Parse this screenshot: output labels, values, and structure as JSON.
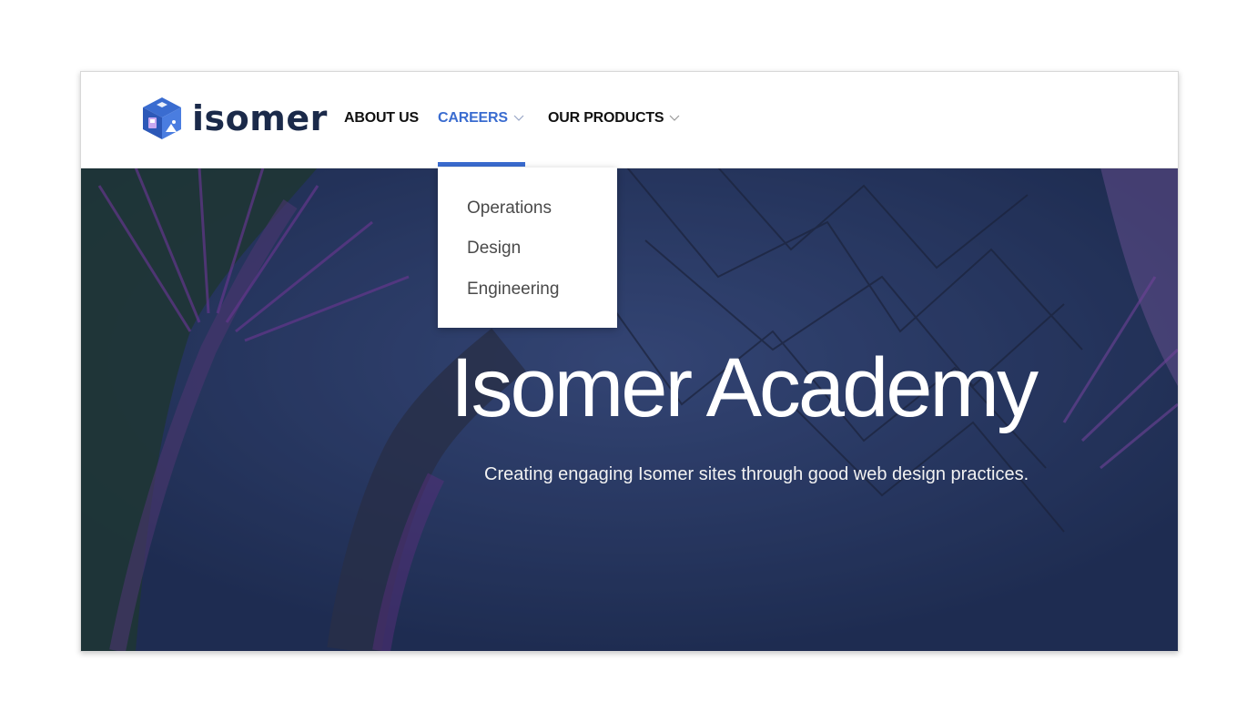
{
  "brand": {
    "logo_icon": "isomer-cube-icon",
    "name": "isomer"
  },
  "nav": {
    "items": [
      {
        "label": "ABOUT US",
        "has_chevron": false
      },
      {
        "label": "CAREERS",
        "has_chevron": true,
        "active": true
      },
      {
        "label": "OUR PRODUCTS",
        "has_chevron": true
      }
    ]
  },
  "dropdown": {
    "items": [
      {
        "label": "Operations"
      },
      {
        "label": "Design"
      },
      {
        "label": "Engineering"
      }
    ]
  },
  "hero": {
    "title": "Isomer Academy",
    "subtitle": "Creating engaging Isomer sites through good web design practices."
  },
  "colors": {
    "accent": "#3a6cd0",
    "brand_text": "#1b2a4a",
    "hero_overlay": "#2b3c6b"
  }
}
